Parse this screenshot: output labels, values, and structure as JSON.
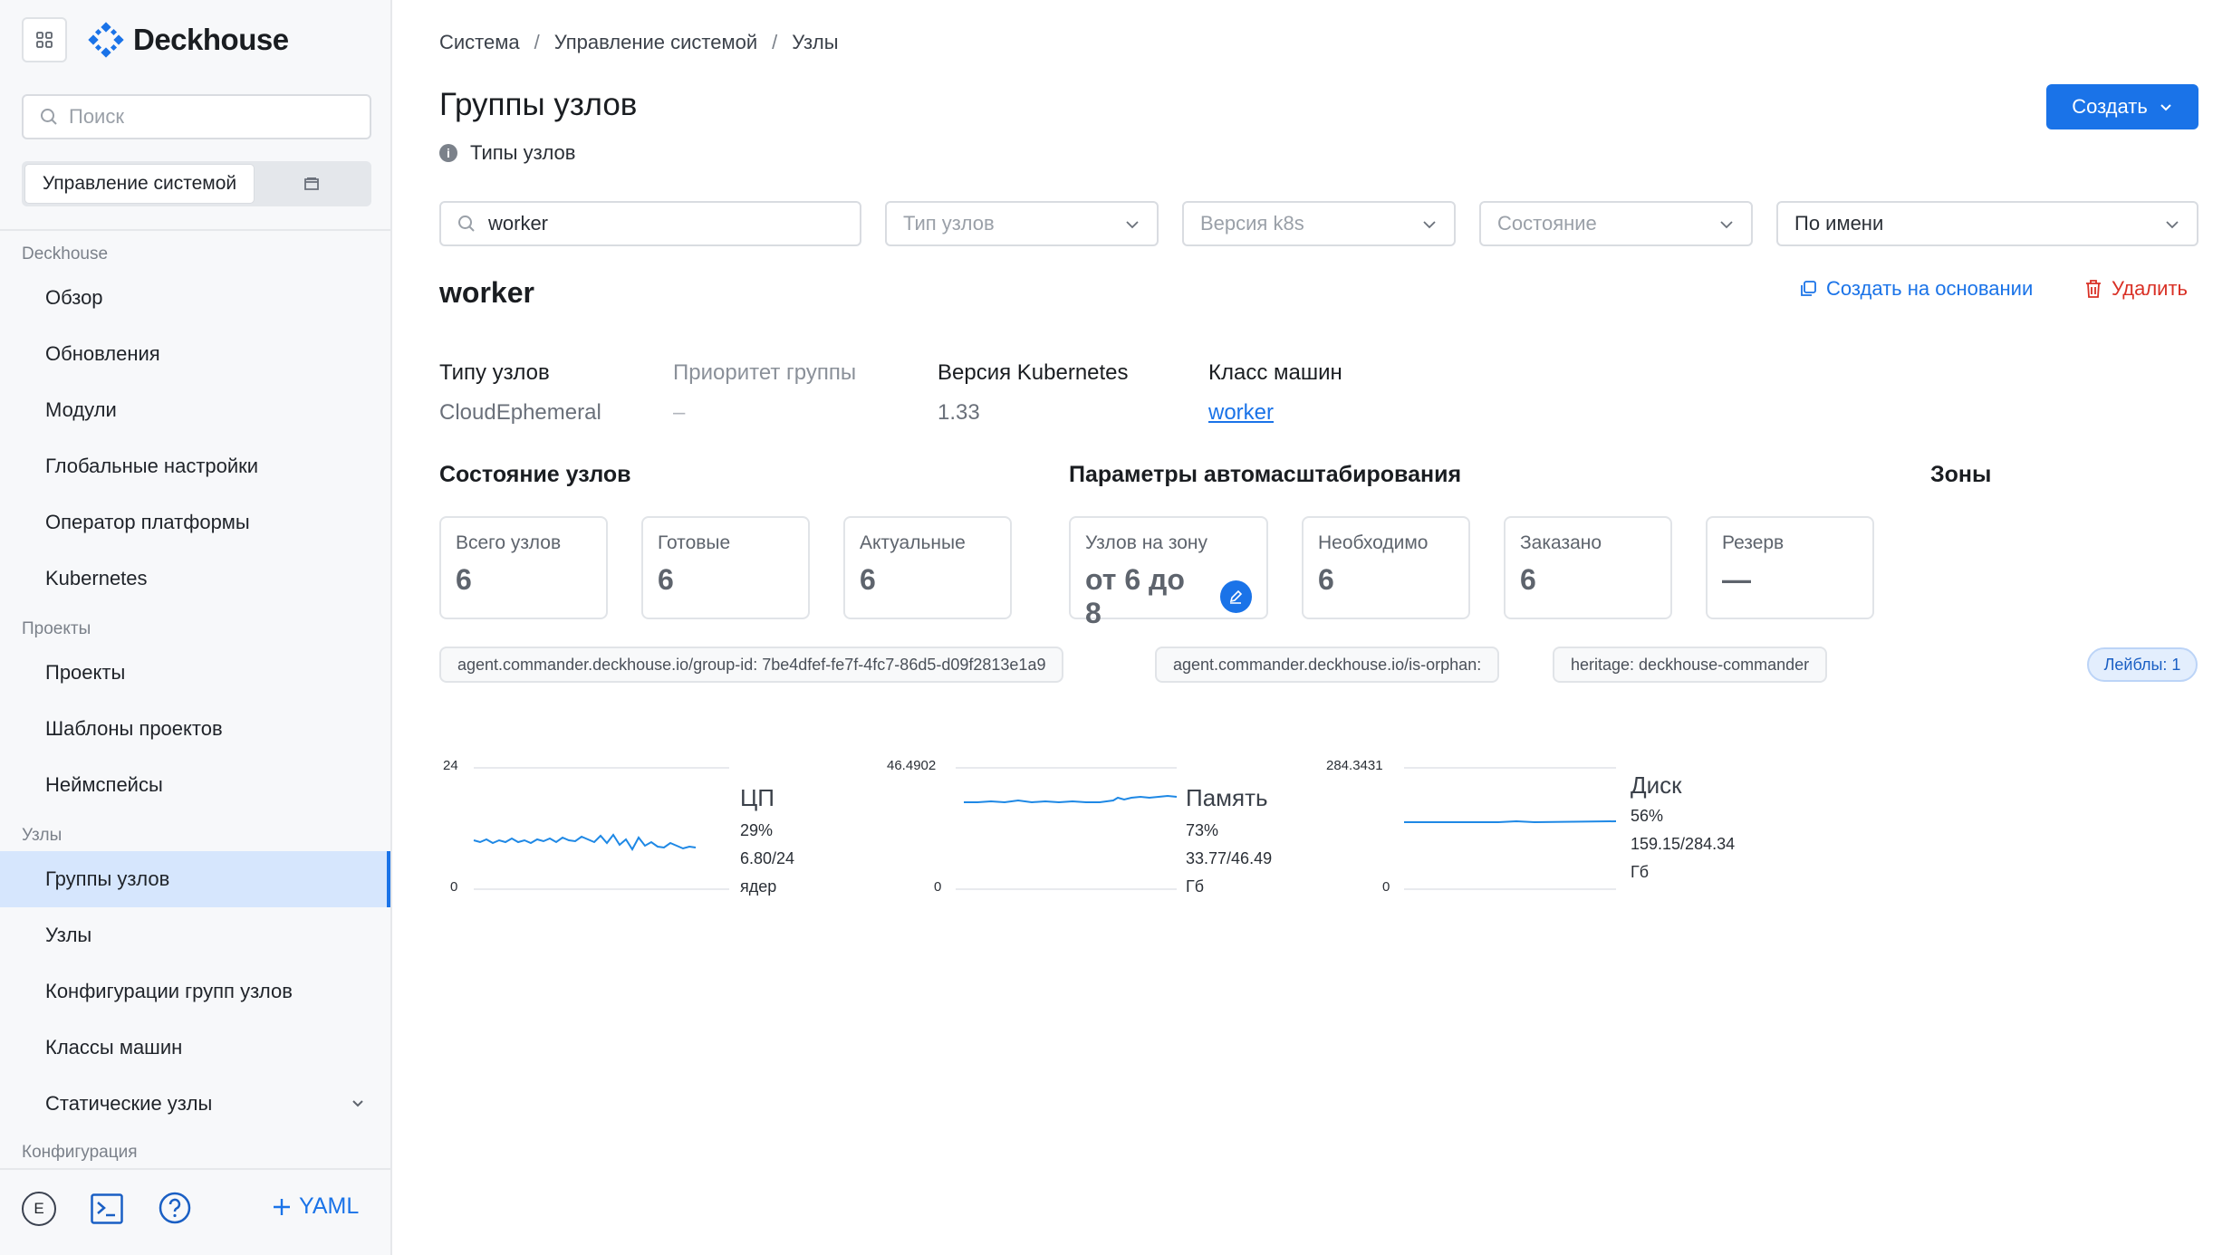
{
  "app": {
    "name": "Deckhouse"
  },
  "sidebar": {
    "search_placeholder": "Поиск",
    "segment_active": "Управление системой",
    "sections": [
      {
        "title": "Deckhouse",
        "items": [
          "Обзор",
          "Обновления",
          "Модули",
          "Глобальные настройки",
          "Оператор платформы",
          "Kubernetes"
        ]
      },
      {
        "title": "Проекты",
        "items": [
          "Проекты",
          "Шаблоны проектов",
          "Неймспейсы"
        ]
      },
      {
        "title": "Узлы",
        "items": [
          "Группы узлов",
          "Узлы",
          "Конфигурации групп узлов",
          "Классы машин",
          "Статические узлы"
        ]
      },
      {
        "title": "Конфигурация",
        "items": []
      }
    ],
    "active_item": "Группы узлов",
    "avatar_letter": "E",
    "yaml_label": "YAML"
  },
  "breadcrumb": [
    "Система",
    "Управление системой",
    "Узлы"
  ],
  "page": {
    "title": "Группы узлов",
    "subtitle": "Типы узлов",
    "create_label": "Создать"
  },
  "filters": {
    "search_value": "worker",
    "node_type_placeholder": "Тип узлов",
    "k8s_version_placeholder": "Версия k8s",
    "state_placeholder": "Состояние",
    "sort_value": "По имени"
  },
  "group": {
    "name": "worker",
    "copy_label": "Создать на основании",
    "delete_label": "Удалить",
    "props": {
      "node_type_label": "Типу узлов",
      "node_type_value": "CloudEphemeral",
      "priority_label": "Приоритет группы",
      "priority_value": "–",
      "k8s_label": "Версия Kubernetes",
      "k8s_value": "1.33",
      "machine_class_label": "Класс машин",
      "machine_class_value": "worker"
    },
    "node_state": {
      "title": "Состояние узлов",
      "cards": [
        {
          "label": "Всего узлов",
          "value": "6"
        },
        {
          "label": "Готовые",
          "value": "6"
        },
        {
          "label": "Актуальные",
          "value": "6"
        }
      ]
    },
    "autoscaling": {
      "title": "Параметры автомасштабирования",
      "cards": [
        {
          "label": "Узлов на зону",
          "value": "от 6 до 8"
        },
        {
          "label": "Необходимо",
          "value": "6"
        },
        {
          "label": "Заказано",
          "value": "6"
        },
        {
          "label": "Резерв",
          "value": "—"
        }
      ]
    },
    "zones_title": "Зоны",
    "labels": [
      "agent.commander.deckhouse.io/group-id: 7be4dfef-fe7f-4fc7-86d5-d09f2813e1a9",
      "agent.commander.deckhouse.io/is-orphan:",
      "heritage: deckhouse-commander"
    ],
    "labels_badge": "Лейблы: 1"
  },
  "metrics": {
    "cpu": {
      "name": "ЦП",
      "max": "24",
      "min": "0",
      "percent": "29%",
      "detail": "6.80/24 ядер"
    },
    "memory": {
      "name": "Память",
      "max": "46.4902",
      "min": "0",
      "percent": "73%",
      "detail": "33.77/46.49 Гб"
    },
    "disk": {
      "name": "Диск",
      "max": "284.3431",
      "min": "0",
      "percent": "56%",
      "detail": "159.15/284.34",
      "unit": "Гб"
    }
  },
  "colors": {
    "accent": "#1a73e8",
    "danger": "#d93025",
    "active_nav_bg": "#d6e6fd"
  }
}
